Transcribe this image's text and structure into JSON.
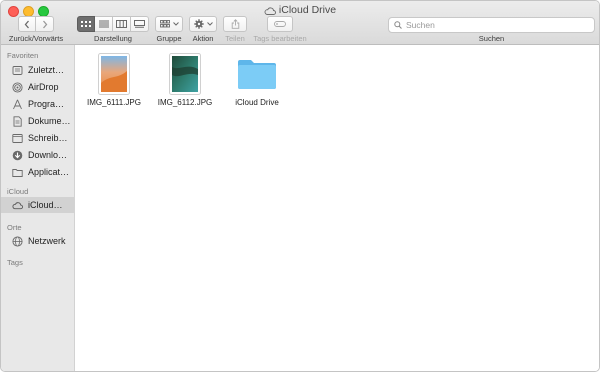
{
  "window": {
    "title": "iCloud Drive"
  },
  "toolbar": {
    "nav_label": "Zurück/Vorwärts",
    "view_label": "Darstellung",
    "group_label": "Gruppe",
    "action_label": "Aktion",
    "share_label": "Teilen",
    "tags_label": "Tags bearbeiten",
    "search_label": "Suchen",
    "search_placeholder": "Suchen"
  },
  "sidebar": {
    "favorites_header": "Favoriten",
    "favorites": [
      {
        "label": "Zuletzt…",
        "icon": "clock-icon"
      },
      {
        "label": "AirDrop",
        "icon": "airdrop-icon"
      },
      {
        "label": "Progra…",
        "icon": "applications-icon"
      },
      {
        "label": "Dokume…",
        "icon": "document-icon"
      },
      {
        "label": "Schreib…",
        "icon": "desktop-icon"
      },
      {
        "label": "Downlo…",
        "icon": "download-icon"
      },
      {
        "label": "Applicat…",
        "icon": "folder-icon"
      }
    ],
    "icloud_header": "iCloud",
    "icloud": [
      {
        "label": "iCloud…",
        "icon": "cloud-icon"
      }
    ],
    "locations_header": "Orte",
    "locations": [
      {
        "label": "Netzwerk",
        "icon": "network-icon"
      }
    ],
    "tags_header": "Tags"
  },
  "files": [
    {
      "name": "IMG_6111.JPG",
      "kind": "image"
    },
    {
      "name": "IMG_6112.JPG",
      "kind": "image"
    },
    {
      "name": "iCloud Drive",
      "kind": "folder"
    }
  ],
  "colors": {
    "folder_blue": "#6ec3f3",
    "selection": "#d2d2d2"
  }
}
